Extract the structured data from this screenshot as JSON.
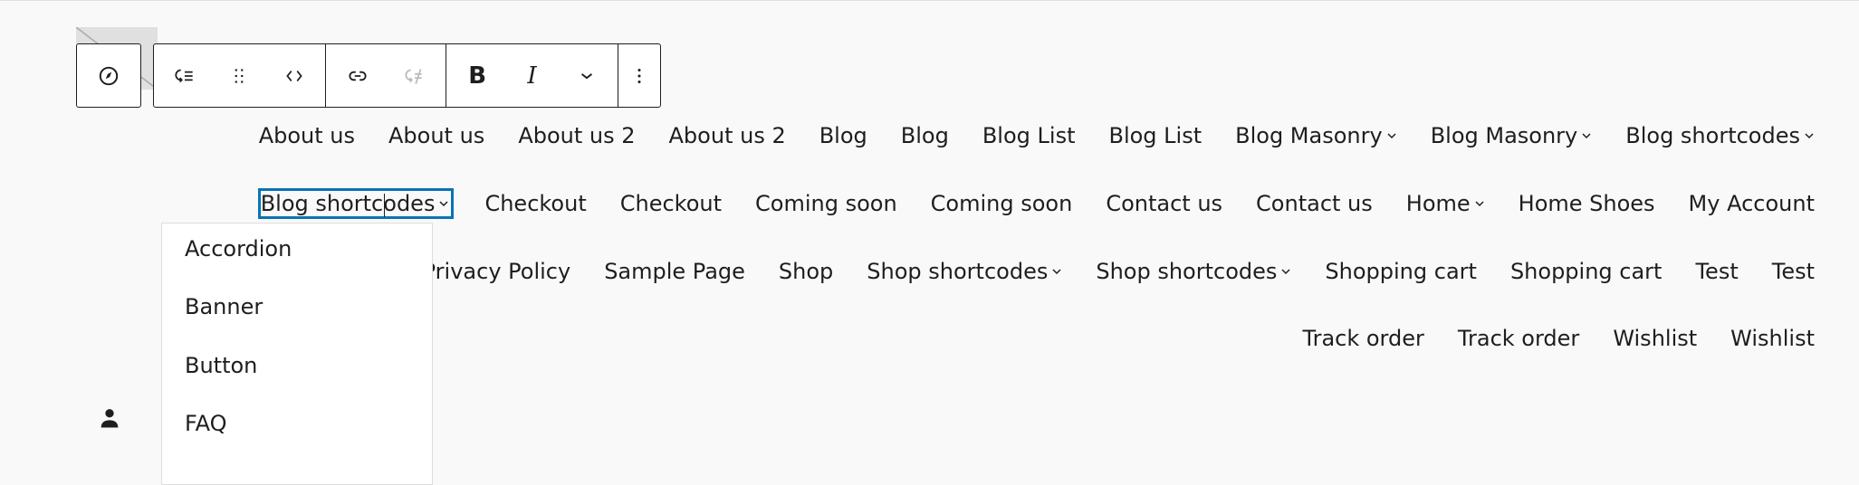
{
  "toolbar": {
    "icons": [
      "compass-icon",
      "list-indent-icon",
      "drag-handle-icon",
      "chevron-left-right-icon",
      "link-icon",
      "unlink-icon",
      "bold-icon",
      "italic-icon",
      "chevron-down-icon",
      "more-vertical-icon"
    ],
    "bold": "B",
    "italic": "I"
  },
  "nav": {
    "rows": [
      [
        {
          "label": "About us"
        },
        {
          "label": "About us"
        },
        {
          "label": "About us 2"
        },
        {
          "label": "About us 2"
        },
        {
          "label": "Blog"
        },
        {
          "label": "Blog"
        },
        {
          "label": "Blog List"
        },
        {
          "label": "Blog List"
        },
        {
          "label": "Blog Masonry",
          "submenu": true
        },
        {
          "label": "Blog Masonry",
          "submenu": true
        },
        {
          "label": "Blog shortcodes",
          "submenu": true
        }
      ],
      [
        {
          "label": "Blog shortcodes",
          "submenu": true,
          "selected": true
        },
        {
          "label": "Checkout"
        },
        {
          "label": "Checkout"
        },
        {
          "label": "Coming soon"
        },
        {
          "label": "Coming soon"
        },
        {
          "label": "Contact us"
        },
        {
          "label": "Contact us"
        },
        {
          "label": "Home",
          "submenu": true
        },
        {
          "label": "Home Shoes"
        },
        {
          "label": "My Account"
        }
      ],
      [
        {
          "label": "Privacy Policy"
        },
        {
          "label": "Sample Page"
        },
        {
          "label": "Shop"
        },
        {
          "label": "Shop shortcodes",
          "submenu": true
        },
        {
          "label": "Shop shortcodes",
          "submenu": true
        },
        {
          "label": "Shopping cart"
        },
        {
          "label": "Shopping cart"
        },
        {
          "label": "Test"
        },
        {
          "label": "Test"
        }
      ],
      [
        {
          "label": "Track order"
        },
        {
          "label": "Track order"
        },
        {
          "label": "Wishlist"
        },
        {
          "label": "Wishlist"
        }
      ]
    ]
  },
  "submenu": {
    "items": [
      "Accordion",
      "Banner",
      "Button",
      "FAQ"
    ]
  },
  "colors": {
    "selection": "#0a73b6",
    "text": "#1e1e1e",
    "background": "#f9f9f9"
  }
}
